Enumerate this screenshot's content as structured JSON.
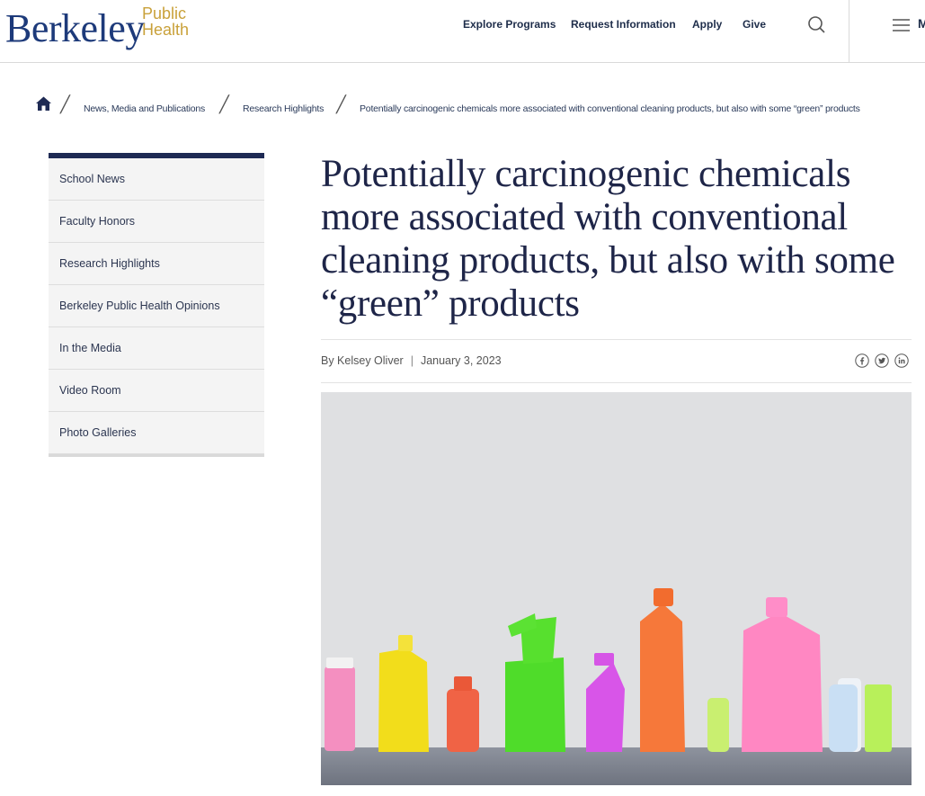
{
  "header": {
    "logo_main": "Berkeley",
    "logo_sub_line1": "Public",
    "logo_sub_line2": "Health",
    "nav": [
      "Explore Programs",
      "Request Information",
      "Apply",
      "Give"
    ],
    "search_icon": "search-icon",
    "menu_icon": "hamburger-menu-icon",
    "menu_label": "M"
  },
  "breadcrumb": {
    "home_icon": "home-icon",
    "items": [
      "News, Media and Publications",
      "Research Highlights",
      "Potentially carcinogenic chemicals more associated with conventional cleaning products, but also with some “green” products"
    ]
  },
  "sidebar": {
    "items": [
      "School News",
      "Faculty Honors",
      "Research Highlights",
      "Berkeley Public Health Opinions",
      "In the Media",
      "Video Room",
      "Photo Galleries"
    ]
  },
  "article": {
    "title": "Potentially carcinogenic chemicals more associated with conventional cleaning products, but also with some “green” products",
    "byline": "By Kelsey Oliver",
    "date": "January 3, 2023",
    "share_icons": [
      "facebook-icon",
      "twitter-icon",
      "linkedin-icon"
    ]
  },
  "colors": {
    "navy": "#1e2a54",
    "gold": "#c9a13a",
    "logo_blue": "#1d3a7a"
  }
}
